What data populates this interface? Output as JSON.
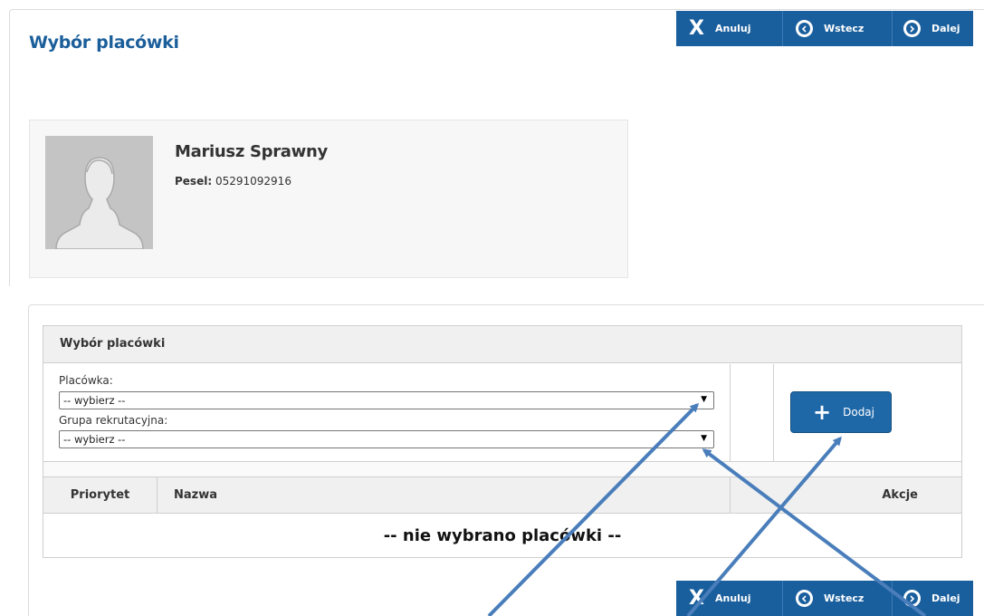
{
  "page": {
    "title": "Wybór placówki"
  },
  "toolbar": {
    "cancel": "Anuluj",
    "back": "Wstecz",
    "next": "Dalej"
  },
  "profile": {
    "name": "Mariusz Sprawny",
    "pesel_label": "Pesel:",
    "pesel_value": "05291092916"
  },
  "panel": {
    "title": "Wybór placówki",
    "facility_label": "Placówka:",
    "facility_value": "-- wybierz --",
    "group_label": "Grupa rekrutacyjna:",
    "group_value": "-- wybierz --",
    "add_label": "Dodaj"
  },
  "table": {
    "columns": [
      "Priorytet",
      "Nazwa",
      "Akcje"
    ],
    "empty_text": "-- nie wybrano placówki --"
  },
  "colors": {
    "brand": "#1a5f9d",
    "title": "#1a5e9a",
    "arrow": "#4a7ebb"
  }
}
